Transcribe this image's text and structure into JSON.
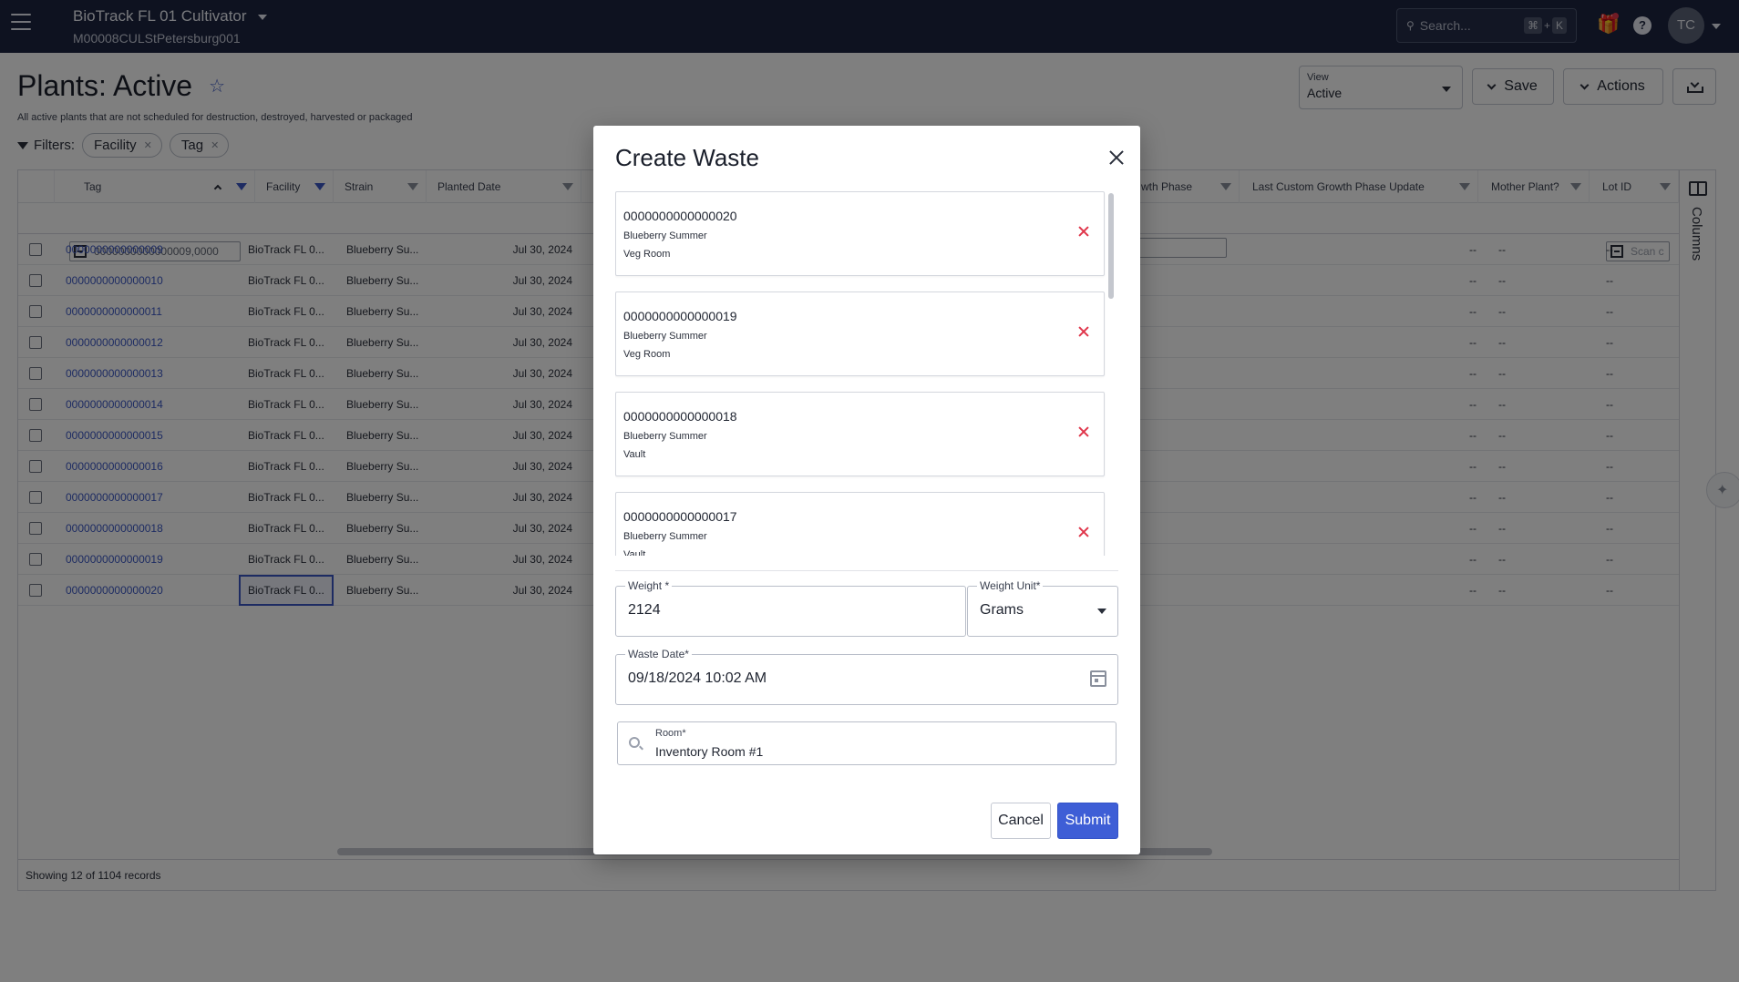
{
  "app": {
    "org_name": "BioTrack FL 01 Cultivator",
    "license": "M00008CULStPetersburg001",
    "search_placeholder": "Search...",
    "search_kbd_1": "⌘",
    "search_kbd_plus": "+",
    "search_kbd_2": "K",
    "help_label": "?",
    "user_initials": "TC"
  },
  "page": {
    "title": "Plants: Active",
    "subtitle": "All active plants that are not scheduled for destruction, destroyed, harvested or packaged",
    "filters_label": "Filters:",
    "filter_chips": [
      "Facility",
      "Tag"
    ],
    "view_label": "View",
    "view_value": "Active",
    "save_label": "Save",
    "actions_label": "Actions"
  },
  "grid": {
    "columns": {
      "tag": "Tag",
      "facility": "Facility",
      "strain": "Strain",
      "planted_date": "Planted Date",
      "growth_phase": "wth Phase",
      "last_custom": "Last Custom Growth Phase Update",
      "mother": "Mother Plant?",
      "lot": "Lot ID"
    },
    "tag_filter_value": "0000000000000009,0000",
    "lot_filter_placeholder": "Scan c",
    "columns_label": "Columns",
    "footer": "Showing 12 of 1104 records",
    "rows": [
      {
        "tag": "0000000000000009",
        "facility": "BioTrack FL 0...",
        "strain": "Blueberry Su...",
        "planted": "Jul 30, 2024",
        "c1": "--",
        "c2": "--",
        "c3": "--"
      },
      {
        "tag": "0000000000000010",
        "facility": "BioTrack FL 0...",
        "strain": "Blueberry Su...",
        "planted": "Jul 30, 2024",
        "c1": "--",
        "c2": "--",
        "c3": "--"
      },
      {
        "tag": "0000000000000011",
        "facility": "BioTrack FL 0...",
        "strain": "Blueberry Su...",
        "planted": "Jul 30, 2024",
        "c1": "--",
        "c2": "--",
        "c3": "--"
      },
      {
        "tag": "0000000000000012",
        "facility": "BioTrack FL 0...",
        "strain": "Blueberry Su...",
        "planted": "Jul 30, 2024",
        "c1": "--",
        "c2": "--",
        "c3": "--"
      },
      {
        "tag": "0000000000000013",
        "facility": "BioTrack FL 0...",
        "strain": "Blueberry Su...",
        "planted": "Jul 30, 2024",
        "c1": "--",
        "c2": "--",
        "c3": "--"
      },
      {
        "tag": "0000000000000014",
        "facility": "BioTrack FL 0...",
        "strain": "Blueberry Su...",
        "planted": "Jul 30, 2024",
        "c1": "--",
        "c2": "--",
        "c3": "--"
      },
      {
        "tag": "0000000000000015",
        "facility": "BioTrack FL 0...",
        "strain": "Blueberry Su...",
        "planted": "Jul 30, 2024",
        "c1": "--",
        "c2": "--",
        "c3": "--"
      },
      {
        "tag": "0000000000000016",
        "facility": "BioTrack FL 0...",
        "strain": "Blueberry Su...",
        "planted": "Jul 30, 2024",
        "c1": "--",
        "c2": "--",
        "c3": "--"
      },
      {
        "tag": "0000000000000017",
        "facility": "BioTrack FL 0...",
        "strain": "Blueberry Su...",
        "planted": "Jul 30, 2024",
        "c1": "--",
        "c2": "--",
        "c3": "--"
      },
      {
        "tag": "0000000000000018",
        "facility": "BioTrack FL 0...",
        "strain": "Blueberry Su...",
        "planted": "Jul 30, 2024",
        "c1": "--",
        "c2": "--",
        "c3": "--"
      },
      {
        "tag": "0000000000000019",
        "facility": "BioTrack FL 0...",
        "strain": "Blueberry Su...",
        "planted": "Jul 30, 2024",
        "c1": "--",
        "c2": "--",
        "c3": "--"
      },
      {
        "tag": "0000000000000020",
        "facility": "BioTrack FL 0...",
        "strain": "Blueberry Su...",
        "planted": "Jul 30, 2024",
        "c1": "--",
        "c2": "--",
        "c3": "--"
      }
    ]
  },
  "modal": {
    "title": "Create Waste",
    "plants": [
      {
        "tag": "0000000000000020",
        "strain": "Blueberry Summer",
        "room": "Veg Room"
      },
      {
        "tag": "0000000000000019",
        "strain": "Blueberry Summer",
        "room": "Veg Room"
      },
      {
        "tag": "0000000000000018",
        "strain": "Blueberry Summer",
        "room": "Vault"
      },
      {
        "tag": "0000000000000017",
        "strain": "Blueberry Summer",
        "room": "Vault"
      }
    ],
    "weight_label": "Weight *",
    "weight_value": "2124",
    "weight_unit_label": "Weight Unit*",
    "weight_unit_value": "Grams",
    "waste_date_label": "Waste Date*",
    "waste_date_value": "09/18/2024 10:02 AM",
    "room_label": "Room*",
    "room_value": "Inventory Room #1",
    "cancel_label": "Cancel",
    "submit_label": "Submit"
  },
  "colors": {
    "topbar": "#1c2540",
    "accent": "#3e5ed6",
    "link": "#3b57c4",
    "remove": "#e0364b"
  }
}
